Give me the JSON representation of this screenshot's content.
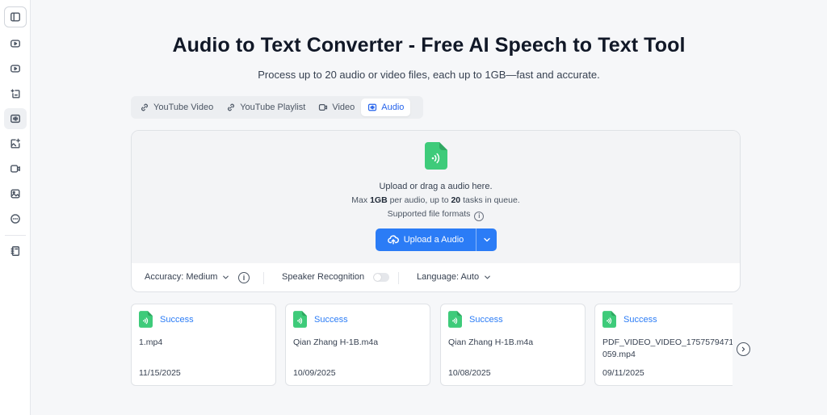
{
  "sidebar": {
    "items": [
      {
        "icon": "sidebar-toggle-icon"
      },
      {
        "icon": "youtube-icon"
      },
      {
        "icon": "youtube-playlist-icon"
      },
      {
        "icon": "file-chat-icon"
      },
      {
        "icon": "audio-wave-icon",
        "active": true
      },
      {
        "icon": "image-sparkle-icon"
      },
      {
        "icon": "video-camera-icon"
      },
      {
        "icon": "image-icon"
      },
      {
        "icon": "more-circle-icon"
      },
      {
        "icon": "notebook-icon"
      }
    ]
  },
  "header": {
    "title": "Audio to Text Converter - Free AI Speech to Text Tool",
    "subtitle": "Process up to 20 audio or video files, each up to 1GB—fast and accurate."
  },
  "tabs": [
    {
      "label": "YouTube Video",
      "icon": "link-icon"
    },
    {
      "label": "YouTube Playlist",
      "icon": "link-icon"
    },
    {
      "label": "Video",
      "icon": "video-icon"
    },
    {
      "label": "Audio",
      "icon": "audio-wave-icon",
      "active": true
    }
  ],
  "upload": {
    "prompt": "Upload or drag a audio here.",
    "limit_prefix": "Max ",
    "limit_size": "1GB",
    "limit_middle": " per audio, up to ",
    "limit_count": "20",
    "limit_suffix": " tasks in queue.",
    "formats_label": "Supported file formats",
    "button_label": "Upload a Audio"
  },
  "options": {
    "accuracy": "Accuracy: Medium",
    "speaker_recognition": "Speaker Recognition",
    "speaker_recognition_on": false,
    "language": "Language: Auto"
  },
  "history": [
    {
      "status": "Success",
      "filename": "1.mp4",
      "date": "11/15/2025"
    },
    {
      "status": "Success",
      "filename": "Qian Zhang H-1B.m4a",
      "date": "10/09/2025"
    },
    {
      "status": "Success",
      "filename": "Qian Zhang H-1B.m4a",
      "date": "10/08/2025"
    },
    {
      "status": "Success",
      "filename": "PDF_VIDEO_VIDEO_1757579471059.mp4",
      "date": "09/11/2025"
    }
  ],
  "colors": {
    "accent": "#2b7cf6",
    "file_icon_green": "#3ecb7a",
    "background": "#f6f7f9"
  }
}
